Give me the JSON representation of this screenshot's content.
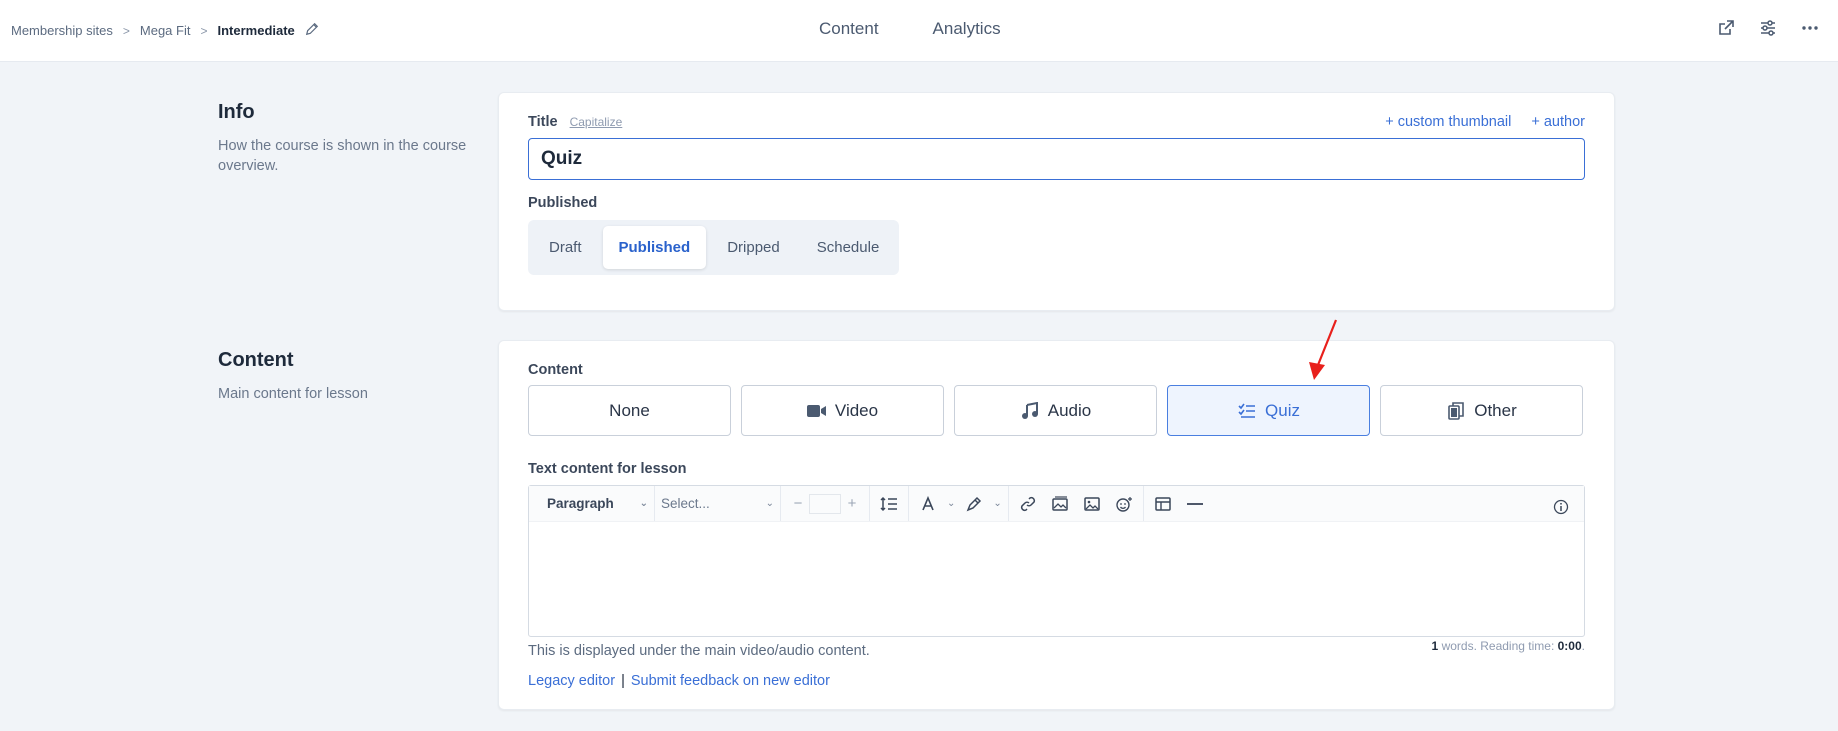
{
  "breadcrumb": {
    "items": [
      "Membership sites",
      "Mega Fit",
      "Intermediate"
    ],
    "separator": ">"
  },
  "tabs": [
    "Content",
    "Analytics"
  ],
  "top_actions": [
    "external-link-icon",
    "settings-sliders-icon",
    "more-icon"
  ],
  "info_section": {
    "heading": "Info",
    "description": "How the course is shown in the course overview."
  },
  "title_field": {
    "label": "Title",
    "capitalize_label": "Capitalize",
    "custom_thumbnail_label": "+ custom thumbnail",
    "author_label": "+ author",
    "value": "Quiz"
  },
  "published_field": {
    "label": "Published",
    "options": [
      "Draft",
      "Published",
      "Dripped",
      "Schedule"
    ],
    "selected": "Published"
  },
  "content_section": {
    "heading": "Content",
    "description": "Main content for lesson"
  },
  "content_type": {
    "label": "Content",
    "options": [
      "None",
      "Video",
      "Audio",
      "Quiz",
      "Other"
    ],
    "selected": "Quiz"
  },
  "text_editor": {
    "label": "Text content for lesson",
    "paragraph_label": "Paragraph",
    "font_select_placeholder": "Select...",
    "minus": "−",
    "plus": "+",
    "helper_text": "This is displayed under the main video/audio content.",
    "word_count": "1",
    "words_label": " words. Reading time: ",
    "reading_time": "0:00",
    "period": "."
  },
  "footer_links": {
    "legacy": "Legacy editor",
    "divider": "|",
    "feedback": "Submit feedback on new editor"
  },
  "colors": {
    "accent": "#3a6fd6",
    "annotation_arrow": "#e8201c"
  }
}
